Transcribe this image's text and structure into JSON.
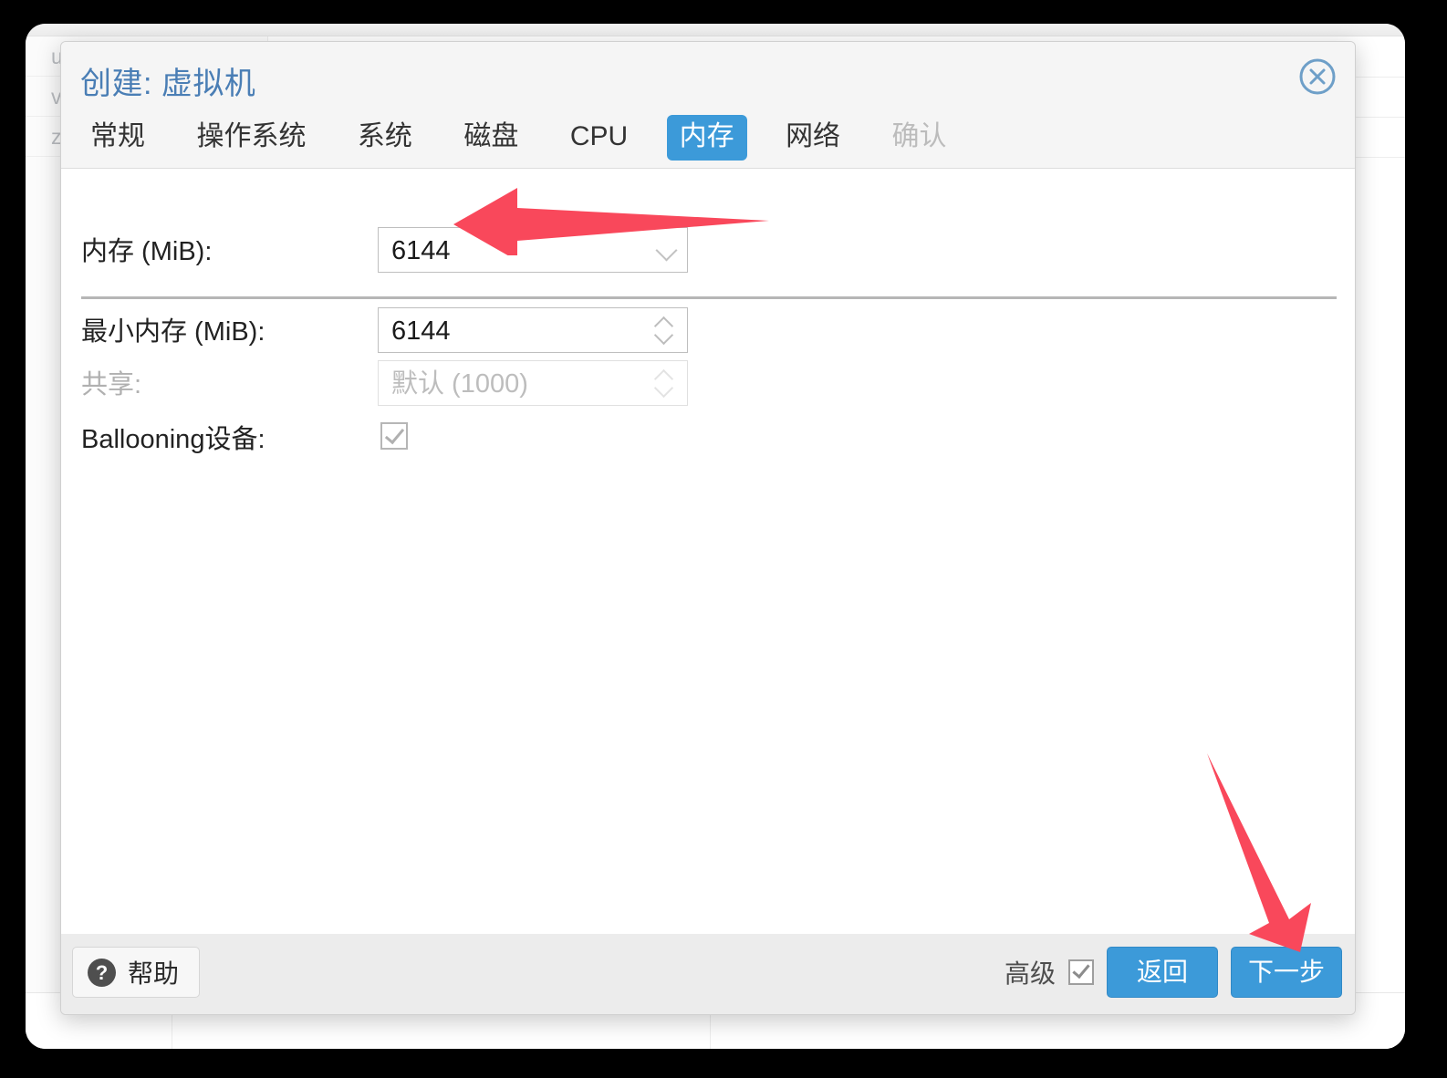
{
  "background_window": {
    "sidebar_rows": [
      "u",
      "v",
      "z"
    ],
    "bottom_cells": [
      "",
      ""
    ]
  },
  "dialog": {
    "title": "创建: 虚拟机",
    "close_icon": "close-circle-icon",
    "tabs": [
      {
        "label": "常规",
        "state": "normal"
      },
      {
        "label": "操作系统",
        "state": "normal"
      },
      {
        "label": "系统",
        "state": "normal"
      },
      {
        "label": "磁盘",
        "state": "normal"
      },
      {
        "label": "CPU",
        "state": "normal"
      },
      {
        "label": "内存",
        "state": "active"
      },
      {
        "label": "网络",
        "state": "normal"
      },
      {
        "label": "确认",
        "state": "disabled"
      }
    ],
    "form": {
      "memory": {
        "label": "内存 (MiB):",
        "value": "6144",
        "control": "combo-spinner",
        "icon": "chevron-down-icon"
      },
      "min_memory": {
        "label": "最小内存 (MiB):",
        "value": "6144",
        "control": "spinner",
        "icon": "spinner-updown-icon"
      },
      "shares": {
        "label": "共享:",
        "placeholder": "默认 (1000)",
        "value": "",
        "control": "spinner",
        "disabled": true,
        "icon": "spinner-updown-icon"
      },
      "ballooning": {
        "label": "Ballooning设备:",
        "checked": true,
        "icon": "checkbox-checked-icon"
      }
    },
    "footer": {
      "help_label": "帮助",
      "help_icon": "question-mark-icon",
      "advanced_label": "高级",
      "advanced_checked": true,
      "back_label": "返回",
      "next_label": "下一步"
    }
  },
  "annotations": {
    "arrow_color": "#f9485b",
    "arrows": [
      {
        "name": "arrow-to-memory-field",
        "direction": "left"
      },
      {
        "name": "arrow-to-next-button",
        "direction": "down-right"
      }
    ]
  },
  "colors": {
    "accent_blue": "#3c9ad9",
    "title_blue": "#4a7eb5",
    "arrow_red": "#f9485b",
    "dialog_chrome": "#f5f5f5",
    "footer_gray": "#ececec"
  }
}
